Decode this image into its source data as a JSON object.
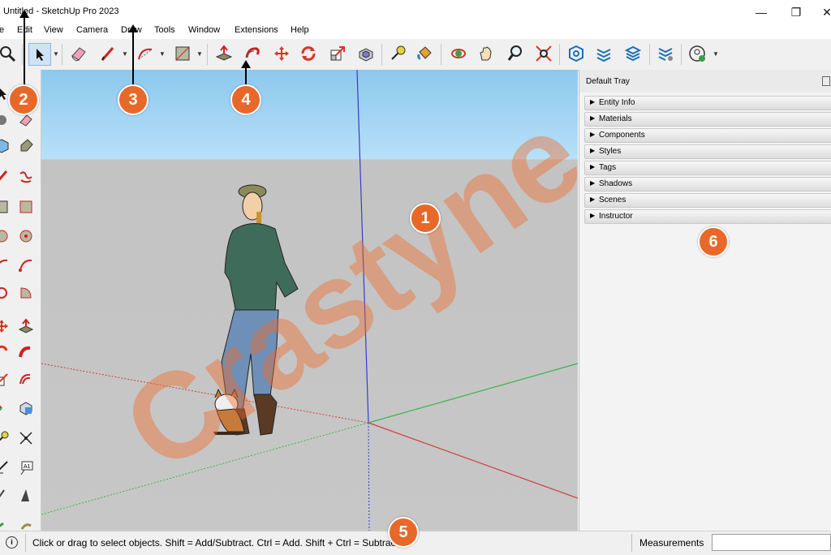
{
  "window": {
    "title": "Untitled - SketchUp Pro 2023",
    "minimize_glyph": "—",
    "restore_glyph": "❐",
    "close_glyph": "✕"
  },
  "menu": [
    "e",
    "Edit",
    "View",
    "Camera",
    "Draw",
    "Tools",
    "Window",
    "Extensions",
    "Help"
  ],
  "toolbar_icons": [
    "zoom-extents",
    "select",
    "eraser",
    "line",
    "arc",
    "rectangle",
    "push-pull",
    "follow-me",
    "move",
    "rotate",
    "scale",
    "offset",
    "tape-measure",
    "paint-bucket",
    "orbit",
    "pan",
    "zoom",
    "zoom-window",
    "3d-warehouse",
    "extension-warehouse",
    "layout",
    "extension-manager",
    "account"
  ],
  "tray": {
    "title": "Default Tray",
    "panels": [
      "Entity Info",
      "Materials",
      "Components",
      "Styles",
      "Tags",
      "Shadows",
      "Scenes",
      "Instructor"
    ]
  },
  "status": {
    "info_icon": "i",
    "text": "Click or drag to select objects. Shift = Add/Subtract. Ctrl = Add. Shift + Ctrl = Subtract.",
    "measurements_label": "Measurements",
    "measurements_value": ""
  },
  "annotations": [
    "1",
    "2",
    "3",
    "4",
    "5",
    "6"
  ],
  "watermark": "Crastyne",
  "colors": {
    "badge": "#e8682a",
    "sky": "#a9d8f5",
    "ground": "#c4c4c4",
    "axis_red": "#d23c3c",
    "axis_green": "#3bb34a",
    "axis_blue": "#3a3ad0"
  }
}
